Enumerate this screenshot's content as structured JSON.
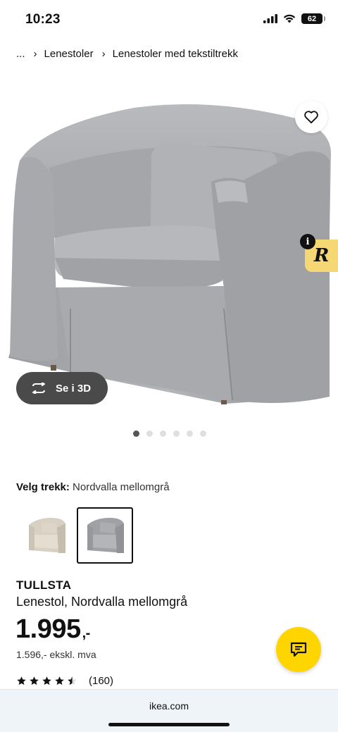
{
  "status_bar": {
    "time": "10:23",
    "battery": "62"
  },
  "breadcrumb": {
    "items": [
      "...",
      "Lenestoler",
      "Lenestoler med tekstiltrekk"
    ]
  },
  "hero": {
    "view_3d_label": "Se i 3D",
    "image_count": 6,
    "active_image": 1
  },
  "cover": {
    "label": "Velg trekk:",
    "value": "Nordvalla mellomgrå",
    "options": [
      "beige",
      "mellomgrå"
    ],
    "selected_index": 1
  },
  "product": {
    "name": "TULLSTA",
    "description": "Lenestol, Nordvalla mellomgrå",
    "price": "1.995",
    "price_suffix": ",-",
    "price_ex_vat": "1.596,- ekskl. mva",
    "rating_stars": 4.5,
    "review_count": "(160)"
  },
  "browser": {
    "url": "ikea.com"
  },
  "colors": {
    "chat_button": "#ffd500",
    "plugin_badge": "#f5d774",
    "view3d_button": "#4a4a4a"
  }
}
